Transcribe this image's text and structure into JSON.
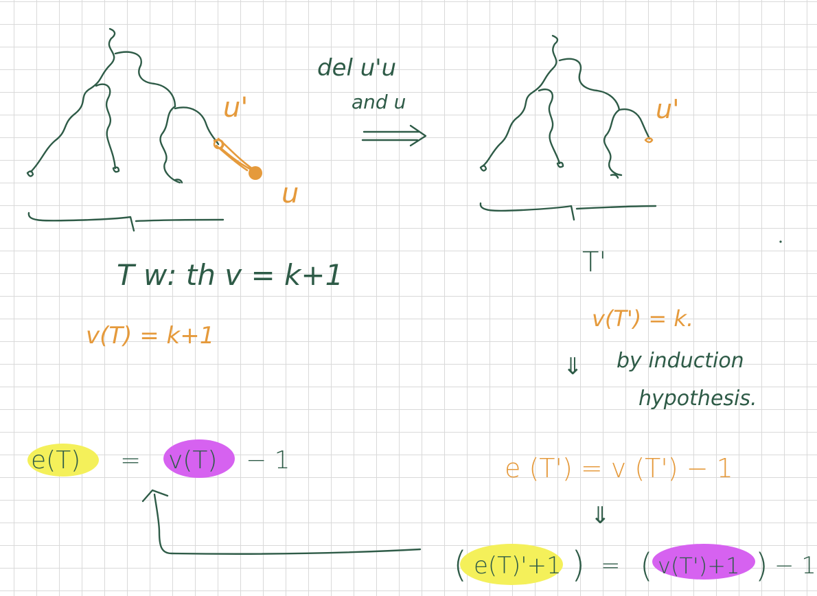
{
  "colors": {
    "ink_green": "#2e5b47",
    "ink_orange": "#e59a3c",
    "highlight_yellow": "#f4f05a",
    "highlight_magenta": "#d662f0",
    "grid": "#d9d9d9"
  },
  "left": {
    "label_u_prime": "u'",
    "label_u": "u",
    "caption": "T  w: th  v = k+1",
    "vertex_count": "v(T) = k+1"
  },
  "arrow": {
    "line1": "del  u'u",
    "line2": "and  u"
  },
  "right": {
    "label_u_prime": "u'",
    "caption": "T'",
    "vertex_count": "v(T') = k.",
    "implies1": "⇓",
    "reason_line1": "by  induction",
    "reason_line2": "hypothesis.",
    "equation": "e (T') = v (T') − 1",
    "implies2": "⇓",
    "bottom_equation": {
      "lhs_open": "(",
      "lhs_highlight": "e(T)'+1",
      "lhs_close": ")",
      "equals": "=",
      "rhs_open": "(",
      "rhs_highlight": "v(T')+1",
      "rhs_close": ")",
      "minus_one": "− 1"
    }
  },
  "goal": {
    "e_highlight": "e(T)",
    "equals": "=",
    "v_highlight": "v(T)",
    "minus_one": "− 1"
  }
}
